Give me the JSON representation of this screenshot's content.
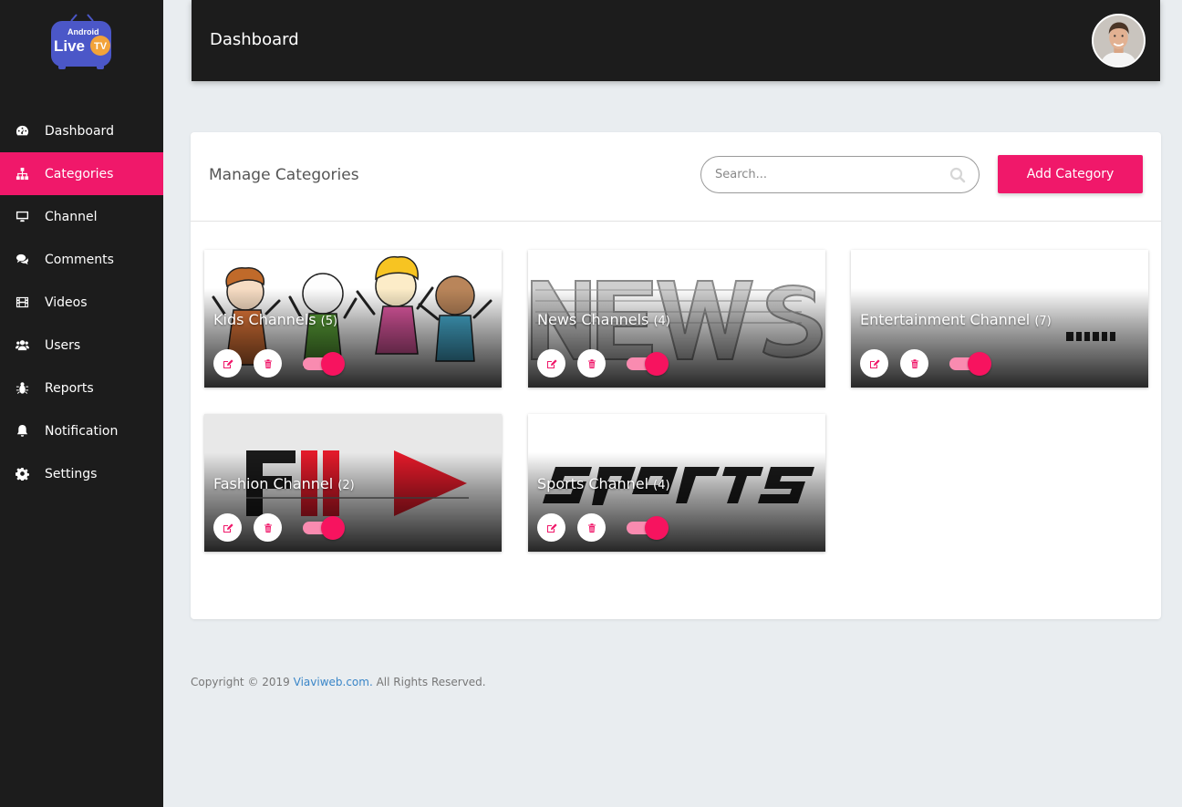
{
  "brand": {
    "logo_line1": "Android",
    "logo_line2": "Live",
    "logo_line3": "TV"
  },
  "sidebar": {
    "items": [
      {
        "label": "Dashboard",
        "icon": "tachometer-icon",
        "active": false
      },
      {
        "label": "Categories",
        "icon": "sitemap-icon",
        "active": true
      },
      {
        "label": "Channel",
        "icon": "desktop-icon",
        "active": false
      },
      {
        "label": "Comments",
        "icon": "comments-icon",
        "active": false
      },
      {
        "label": "Videos",
        "icon": "film-icon",
        "active": false
      },
      {
        "label": "Users",
        "icon": "users-icon",
        "active": false
      },
      {
        "label": "Reports",
        "icon": "bug-icon",
        "active": false
      },
      {
        "label": "Notification",
        "icon": "bell-icon",
        "active": false
      },
      {
        "label": "Settings",
        "icon": "gear-icon",
        "active": false
      }
    ]
  },
  "header": {
    "title": "Dashboard"
  },
  "main": {
    "panel_title": "Manage Categories",
    "search": {
      "placeholder": "Search..."
    },
    "add_button": "Add Category",
    "categories": [
      {
        "name": "Kids Channels",
        "count": "(5)",
        "image": "kids",
        "enabled": true
      },
      {
        "name": "News Channels",
        "count": "(4)",
        "image": "news",
        "enabled": true
      },
      {
        "name": "Entertainment Channel",
        "count": "(7)",
        "image": "entertainment",
        "enabled": true
      },
      {
        "name": "Fashion Channel",
        "count": "(2)",
        "image": "fashion",
        "enabled": true
      },
      {
        "name": "Sports Channel",
        "count": "(4)",
        "image": "sports",
        "enabled": true
      }
    ]
  },
  "footer": {
    "prefix": "Copyright © 2019 ",
    "link": "Viaviweb.com.",
    "suffix": " All Rights Reserved."
  },
  "colors": {
    "accent": "#f0186a",
    "sidebar_bg": "#1c1c1c",
    "page_bg": "#e9edf0"
  }
}
